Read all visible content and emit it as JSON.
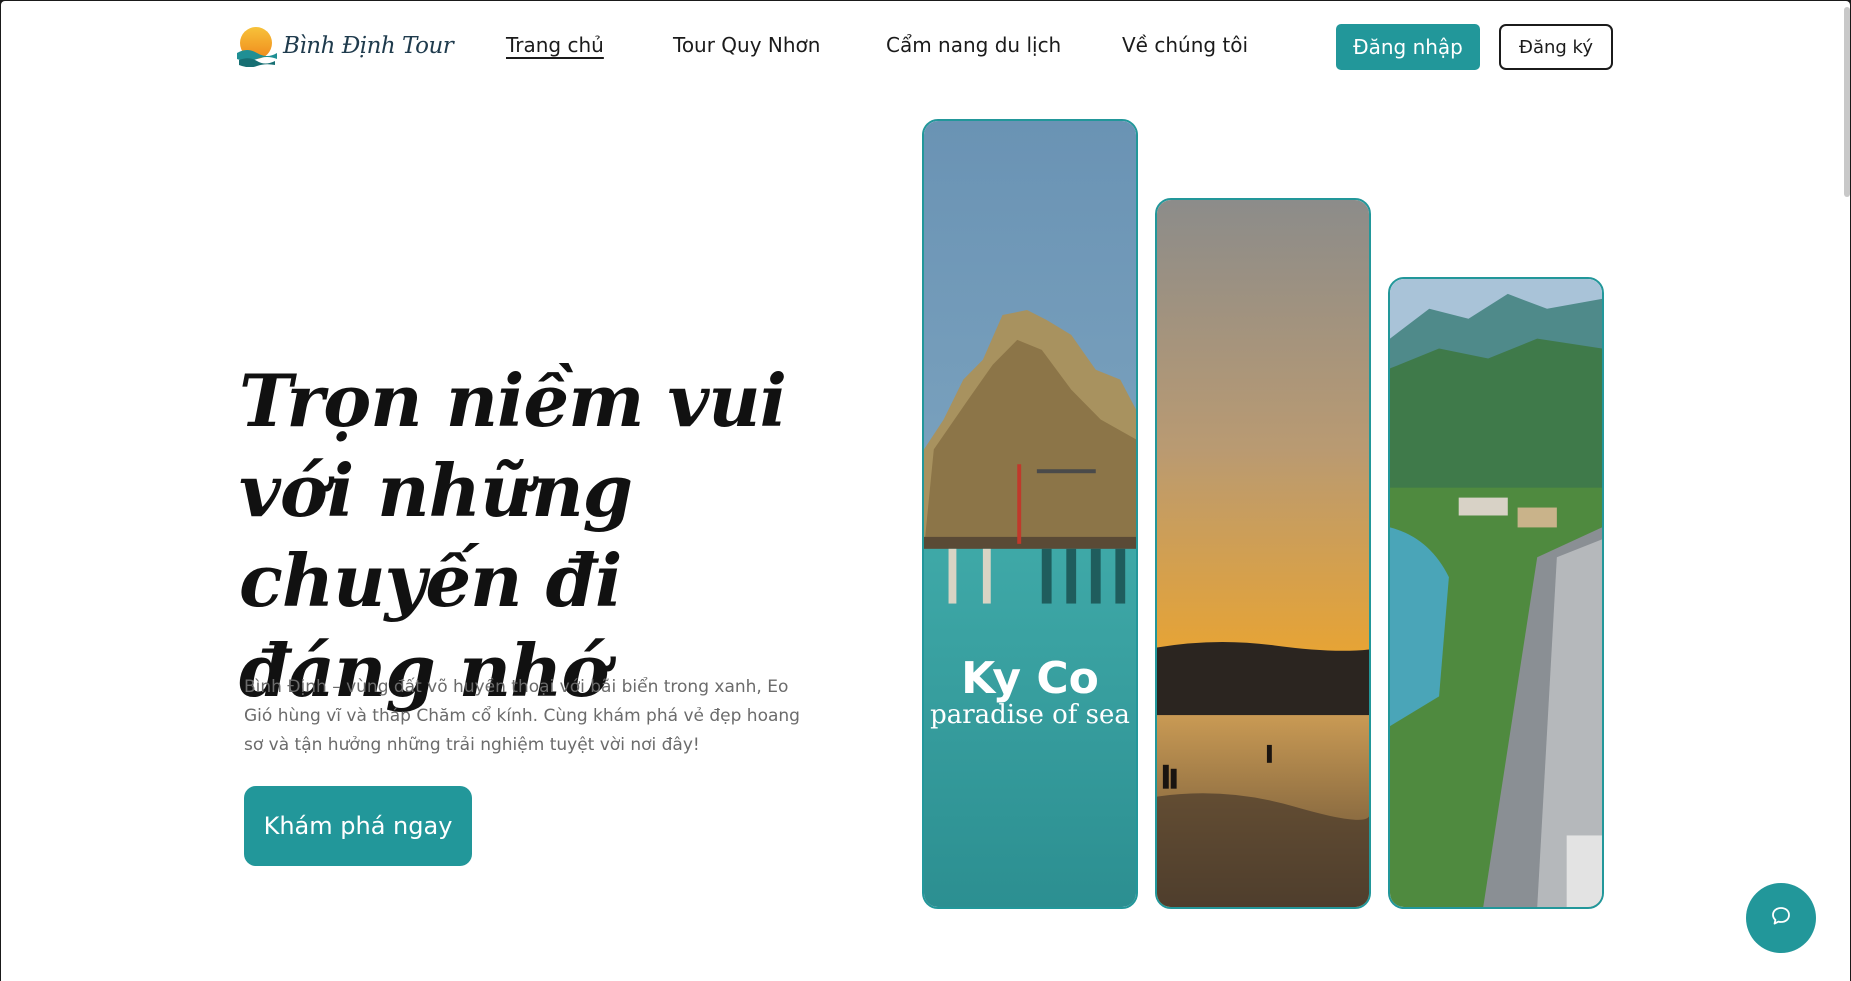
{
  "brand": {
    "name": "Bình Định Tour",
    "accent": "#22979a"
  },
  "nav": {
    "items": [
      {
        "label": "Trang chủ",
        "active": true
      },
      {
        "label": "Tour Quy Nhơn",
        "active": false
      },
      {
        "label": "Cẩm nang du lịch",
        "active": false
      },
      {
        "label": "Về chúng tôi",
        "active": false
      }
    ],
    "login_label": "Đăng nhập",
    "register_label": "Đăng ký"
  },
  "hero": {
    "title": "Trọn niềm vui với những chuyến đi đáng nhớ",
    "description": "Bình Định – vùng đất võ huyền thoại với bãi biển trong xanh, Eo Gió hùng vĩ và tháp Chăm cổ kính. Cùng khám phá vẻ đẹp hoang sơ và tận hưởng những trải nghiệm tuyệt vời nơi đây!",
    "cta_label": "Khám phá ngay"
  },
  "cards": [
    {
      "caption_big": "Ky Co",
      "caption_small": "paradise of sea"
    },
    {
      "caption_big": "",
      "caption_small": ""
    },
    {
      "caption_big": "",
      "caption_small": ""
    }
  ],
  "chat": {
    "icon": "chat-bubble-icon"
  }
}
